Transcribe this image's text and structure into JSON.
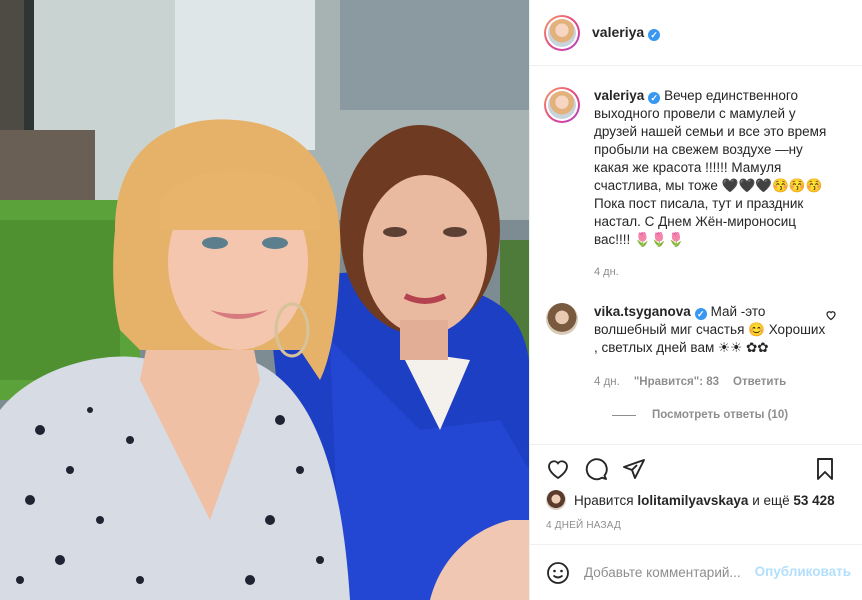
{
  "photo": {
    "alt_icon": "photo-image"
  },
  "header": {
    "username": "valeriya",
    "verified_icon": "verified-badge-icon"
  },
  "caption": {
    "username": "valeriya",
    "text": "Вечер единственного выходного провели с мамулей у друзей нашей семьи и все это время пробыли на свежем воздухе —ну какая же красота !!!!!! Мамуля счастлива, мы тоже 🖤🖤🖤😚😚😚 Пока пост писала, тут и праздник настал. С Днем Жён-мироносиц вас!!!! 🌷🌷🌷",
    "time": "4 дн."
  },
  "comment": {
    "username": "vika.tsyganova",
    "text": "Май -это волшебный миг счастья 😊 Хороших , светлых дней вам ☀☀ ✿✿",
    "time": "4 дн.",
    "likes": "\"Нравится\": 83",
    "reply": "Ответить",
    "view_replies": "Посмотреть ответы (10)"
  },
  "likes": {
    "prefix": "Нравится",
    "user": "lolitamilyavskaya",
    "mid": "и ещё",
    "count": "53 428"
  },
  "post_date": "4 ДНЕЙ НАЗАД",
  "add_comment": {
    "placeholder": "Добавьте комментарий...",
    "publish": "Опубликовать"
  },
  "colors": {
    "accent": "#3897f0",
    "publish_disabled": "#b2dffc",
    "muted": "#8e8e8e"
  }
}
